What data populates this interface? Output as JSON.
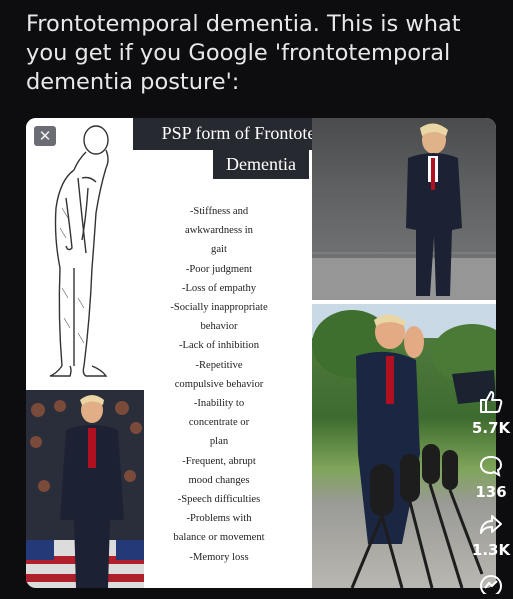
{
  "post": {
    "caption": "Frontotemporal dementia. This is what you get if you Google 'frontotemporal dementia posture':"
  },
  "image": {
    "title_line1": "PSP form of Frontotemporal",
    "title_line2": "Dementia",
    "symptoms": [
      "-Stiffness and\nawkwardness in\ngait",
      "-Poor judgment",
      "-Loss of empathy",
      "-Socially inappropriate\nbehavior",
      "-Lack of inhibition",
      "-Repetitive\ncompulsive behavior",
      "-Inability to\nconcentrate or\nplan",
      "-Frequent, abrupt\nmood changes",
      "-Speech difficulties",
      "-Problems with\nbalance or movement",
      "-Memory loss"
    ],
    "close_glyph": "✕"
  },
  "actions": {
    "likes": "5.7K",
    "comments": "136",
    "shares": "1.3K"
  },
  "icons": [
    "close-icon",
    "like-icon",
    "comment-icon",
    "share-icon",
    "views-icon"
  ]
}
